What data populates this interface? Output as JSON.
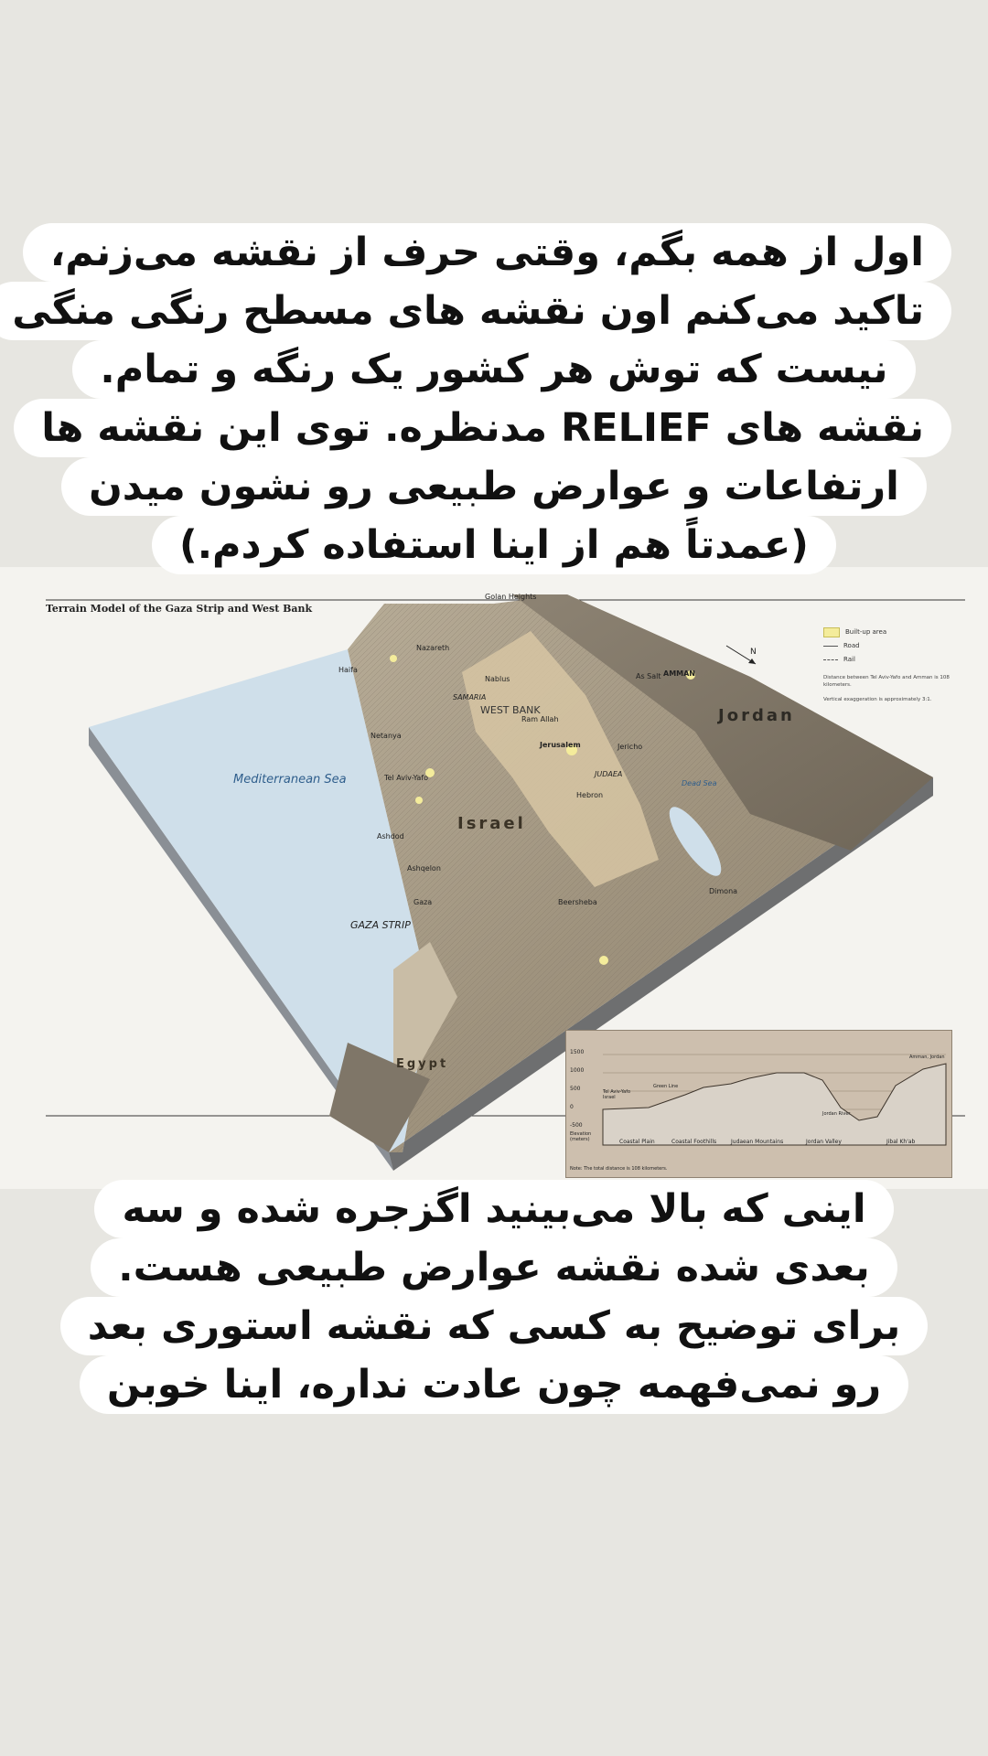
{
  "caption_top": {
    "lines": [
      "اول از همه بگم، وقتی حرف از نقشه می‌زنم،",
      "تاکید می‌کنم اون نقشه های مسطح رنگی منگی",
      "نیست که توش هر کشور یک رنگه و تمام.",
      "نقشه های RELIEF مدنظره. توی این نقشه ها",
      "ارتفاعات و عوارض طبیعی رو نشون میدن",
      "(عمدتاً هم از اینا استفاده کردم.)"
    ]
  },
  "caption_bottom": {
    "lines": [
      "اینی که بالا می‌بینید اگزجره شده و سه",
      "بعدی شده نقشه عوارض طبیعی هست.",
      "برای توضیح به کسی که نقشه استوری بعد",
      "رو نمی‌فهمه چون عادت نداره، اینا خوبن"
    ]
  },
  "map": {
    "title": "Terrain Model of the Gaza Strip and West Bank",
    "legend": {
      "built_up": "Built-up area",
      "road": "Road",
      "rail": "Rail",
      "note1": "Distance between Tel Aviv-Yafo and Amman is 108 kilometers.",
      "note2": "Vertical exaggeration is approximately 3:1."
    },
    "north": "N",
    "labels": {
      "golan": "Golan Heights",
      "jordan": "Jordan",
      "amman": "AMMAN",
      "mediterranean": "Mediterranean Sea",
      "west_bank": "WEST BANK",
      "samaria": "SAMARIA",
      "judaea": "JUDAEA",
      "israel": "Israel",
      "gaza": "GAZA STRIP",
      "egypt": "Egypt",
      "dead_sea": "Dead Sea",
      "haifa": "Haifa",
      "nazareth": "Nazareth",
      "netanya": "Netanya",
      "tel_aviv": "Tel Aviv-Yafo",
      "jerusalem": "Jerusalem",
      "hebron": "Hebron",
      "jericho": "Jericho",
      "nablus": "Nablus",
      "ramallah": "Ram Allah",
      "ashdod": "Ashdod",
      "ashqelon": "Ashqelon",
      "gaza_city": "Gaza",
      "beersheba": "Beersheba",
      "dimona": "Dimona",
      "as_salt": "As Salt"
    },
    "profile": {
      "ticks": [
        "1500",
        "1000",
        "500",
        "0",
        "-500"
      ],
      "ylabel": "Elevation (meters)",
      "regions": [
        "Coastal Plain",
        "Coastal Foothills",
        "Judaean Mountains",
        "Jordan Valley",
        "Jibal Kh'ab"
      ],
      "places": [
        "Tel Aviv-Yafo Israel",
        "Green Line",
        "Jordan River",
        "Amman, Jordan"
      ],
      "note": "Note: The total distance is 108 kilometers."
    }
  },
  "colors": {
    "background": "#e7e6e1",
    "caption_bg": "#ffffff",
    "sea": "#cfdfea",
    "terrain": "#a79c88",
    "built_up": "#f4ec9b"
  }
}
